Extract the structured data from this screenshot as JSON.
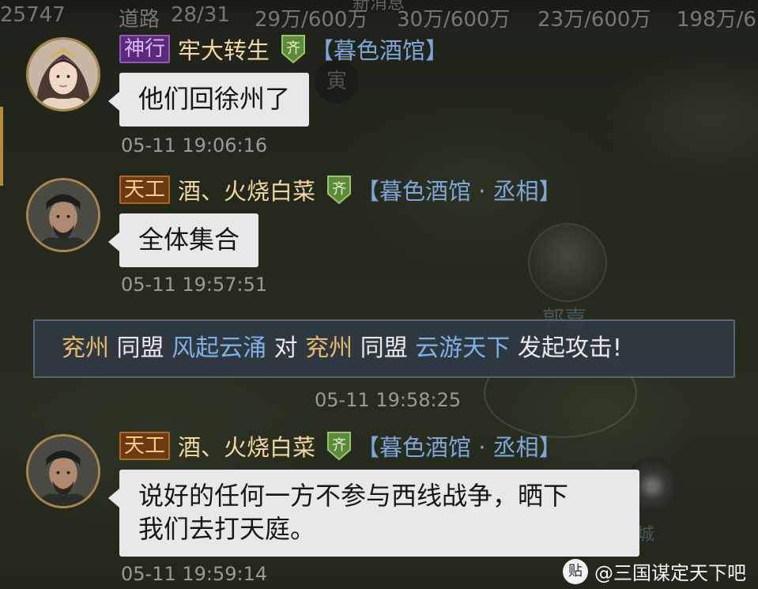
{
  "topbar": {
    "title": "新消息",
    "cells": [
      "25747",
      "道路",
      "28/31",
      "29万/600万",
      "30万/600万",
      "23万/600万",
      "198万/6"
    ]
  },
  "map": {
    "badge": "寅",
    "labels": [
      "郭嘉",
      "城"
    ]
  },
  "messages": [
    {
      "tag": "神行",
      "tag_color": "#5b2a7c",
      "name": "牢大转生",
      "faction": "齐",
      "guild": "【暮色酒馆】",
      "text": "他们回徐州了",
      "time": "05-11 19:06:16",
      "avatar": "female-portrait"
    },
    {
      "tag": "天工",
      "tag_color": "#6e3a12",
      "name": "酒、火烧白菜",
      "faction": "齐",
      "guild": "【暮色酒馆 · 丞相】",
      "text": "全体集合",
      "time": "05-11 19:57:51",
      "avatar": "male-portrait"
    },
    {
      "tag": "天工",
      "tag_color": "#6e3a12",
      "name": "酒、火烧白菜",
      "faction": "齐",
      "guild": "【暮色酒馆 · 丞相】",
      "text_line1": "说好的任何一方不参与西线战争，晒下",
      "text_line2": "我们去打天庭。",
      "time": "05-11 19:59:14",
      "avatar": "male-portrait"
    }
  ],
  "system": {
    "region1": "兖州",
    "w1": "同盟",
    "alliance1": "风起云涌",
    "w2": "对",
    "region2": "兖州",
    "w3": "同盟",
    "alliance2": "云游天下",
    "w4": "发起攻击!",
    "time": "05-11 19:58:25"
  },
  "watermark": {
    "icon": "贴",
    "text": "@三国谋定天下吧"
  },
  "colors": {
    "bubble": "#e8e8e8",
    "guild": "#7fa6d8",
    "username": "#f2d8a0",
    "system_gold": "#e8b86a",
    "system_blue": "#7fb0e4"
  }
}
